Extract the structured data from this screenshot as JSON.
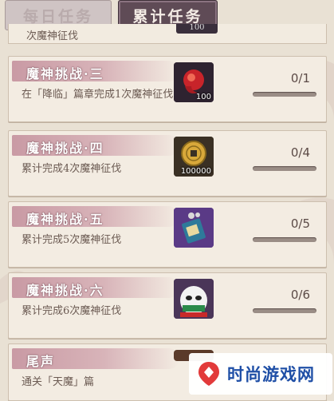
{
  "tabs": {
    "daily": "每日任务",
    "accumulated": "累计任务"
  },
  "partial_task": {
    "desc_tail": "次魔神征伐",
    "reward_qty": "100"
  },
  "tasks": [
    {
      "title": "魔神挑战·三",
      "desc": "在「降临」篇章完成1次魔神征伐",
      "reward_icon": "red-magatama-icon",
      "reward_qty": "100",
      "progress": "0/1",
      "progress_value": 0
    },
    {
      "title": "魔神挑战·四",
      "desc": "累计完成4次魔神征伐",
      "reward_icon": "gold-coin-icon",
      "reward_qty": "100000",
      "progress": "0/4",
      "progress_value": 0
    },
    {
      "title": "魔神挑战·五",
      "desc": "累计完成5次魔神征伐",
      "reward_icon": "amulet-ticket-icon",
      "reward_qty": "",
      "progress": "0/5",
      "progress_value": 0
    },
    {
      "title": "魔神挑战·六",
      "desc": "累计完成6次魔神征伐",
      "reward_icon": "daruma-material-icon",
      "reward_qty": "",
      "progress": "0/6",
      "progress_value": 0
    },
    {
      "title": "尾声",
      "desc": "通关「天魔」篇",
      "reward_icon": "",
      "reward_qty": "",
      "progress": "",
      "progress_value": 0
    }
  ],
  "watermark": {
    "text": "时尚游戏网"
  },
  "colors": {
    "active_tab": "#5f4b56",
    "banner": "#c99aa4",
    "card_bg": "#f3ece2"
  }
}
